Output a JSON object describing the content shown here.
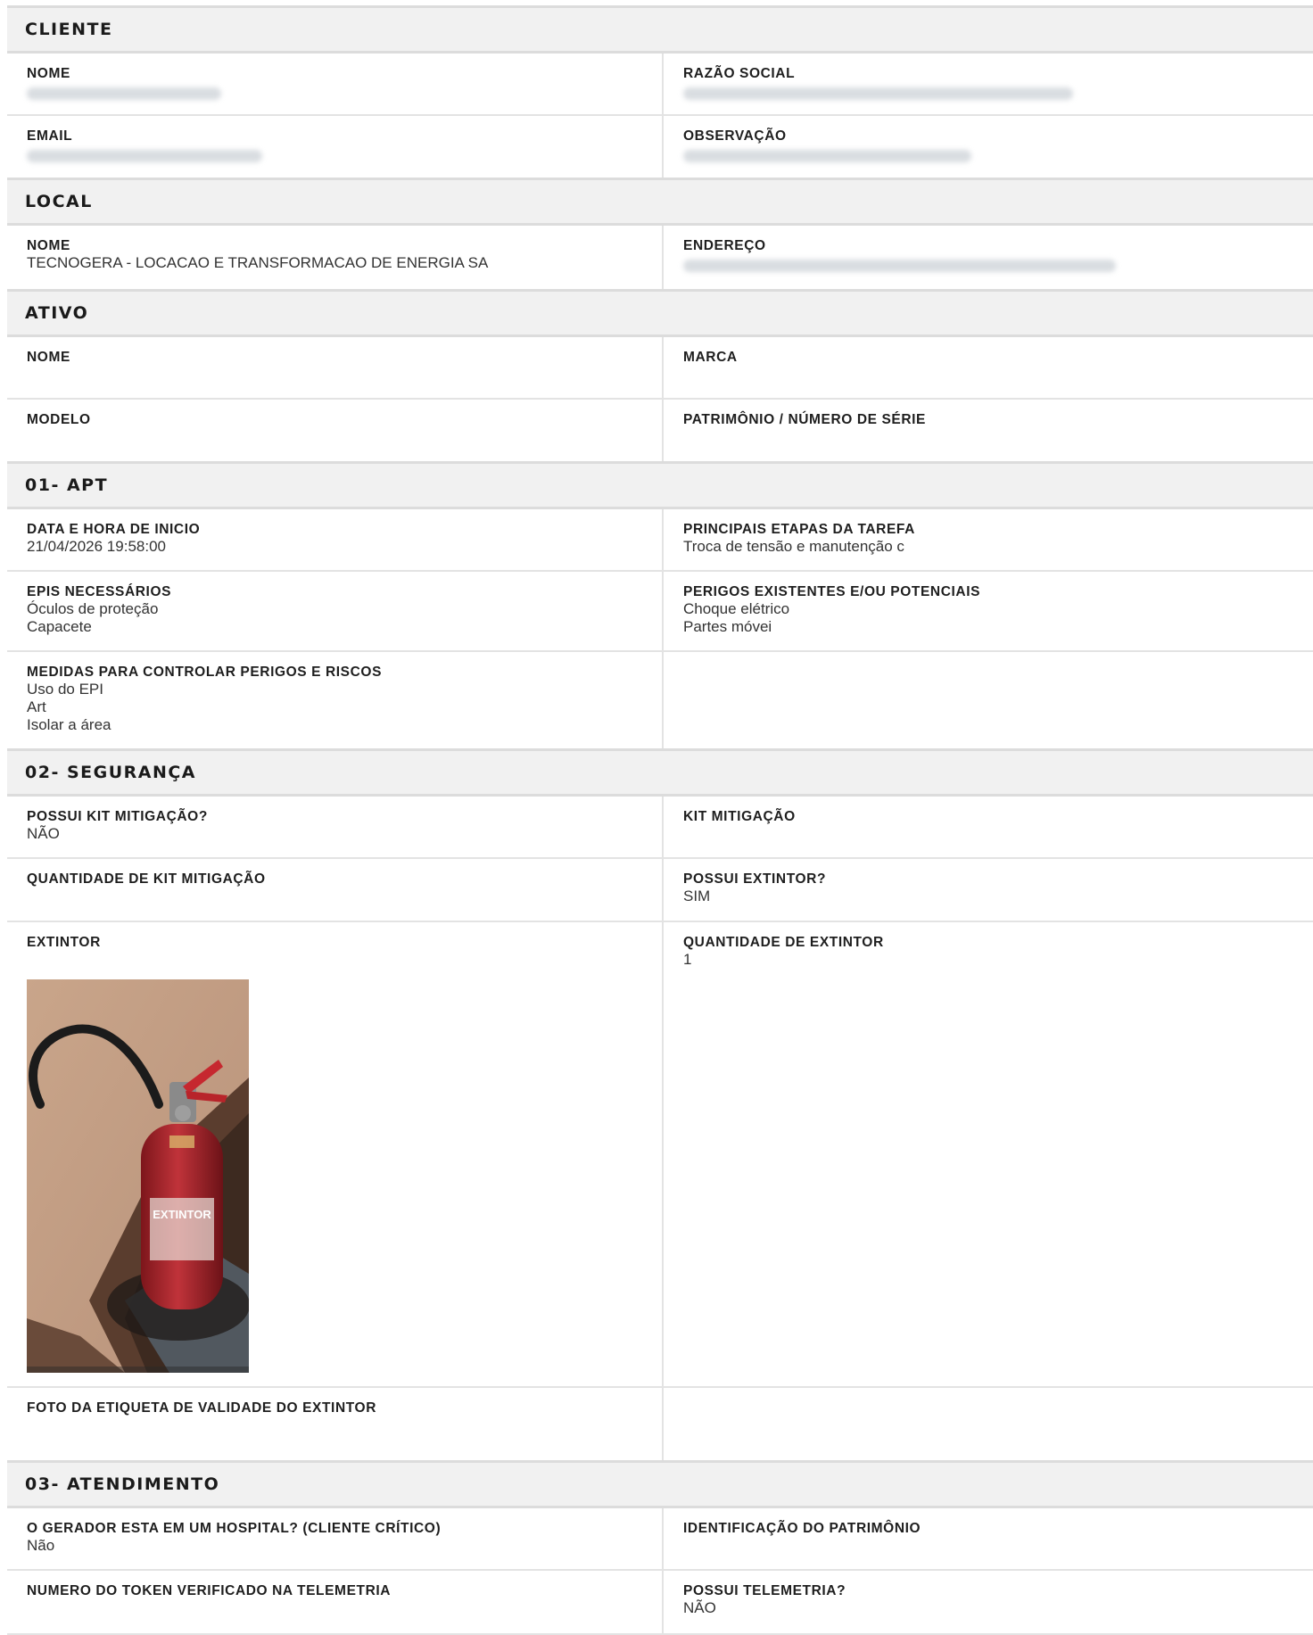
{
  "cliente": {
    "title": "CLIENTE",
    "nome_label": "NOME",
    "razao_label": "RAZÃO SOCIAL",
    "email_label": "EMAIL",
    "observacao_label": "OBSERVAÇÃO"
  },
  "local": {
    "title": "LOCAL",
    "nome_label": "NOME",
    "nome_value": "TECNOGERA - LOCACAO E TRANSFORMACAO DE ENERGIA SA",
    "endereco_label": "ENDEREÇO"
  },
  "ativo": {
    "title": "ATIVO",
    "nome_label": "NOME",
    "marca_label": "MARCA",
    "modelo_label": "MODELO",
    "patrimonio_label": "PATRIMÔNIO / NÚMERO DE SÉRIE"
  },
  "apt": {
    "title": "01- APT",
    "data_label": "DATA E HORA DE INICIO",
    "data_value": "21/04/2026 19:58:00",
    "etapas_label": "PRINCIPAIS ETAPAS DA TAREFA",
    "etapas_value": "Troca de tensão e manutenção c",
    "epis_label": "EPIS NECESSÁRIOS",
    "epis_value": "Óculos de proteção\nCapacete",
    "perigos_label": "PERIGOS EXISTENTES E/OU POTENCIAIS",
    "perigos_value": "Choque elétrico\nPartes móvei",
    "medidas_label": "MEDIDAS PARA CONTROLAR PERIGOS E RISCOS",
    "medidas_value": "Uso do EPI\nArt\nIsolar a área"
  },
  "seguranca": {
    "title": "02- SEGURANÇA",
    "possui_kit_label": "POSSUI KIT MITIGAÇÃO?",
    "possui_kit_value": "NÃO",
    "kit_label": "KIT MITIGAÇÃO",
    "qtd_kit_label": "QUANTIDADE DE KIT MITIGAÇÃO",
    "possui_extintor_label": "POSSUI EXTINTOR?",
    "possui_extintor_value": "SIM",
    "extintor_label": "EXTINTOR",
    "qtd_extintor_label": "QUANTIDADE DE EXTINTOR",
    "qtd_extintor_value": "1",
    "foto_etiqueta_label": "FOTO DA ETIQUETA DE VALIDADE DO EXTINTOR",
    "extintor_photo_text": "EXTINTOR"
  },
  "atendimento": {
    "title": "03- ATENDIMENTO",
    "hospital_label": "O GERADOR ESTA EM UM HOSPITAL? (CLIENTE CRÍTICO)",
    "hospital_value": "Não",
    "identificacao_label": "IDENTIFICAÇÃO DO PATRIMÔNIO",
    "token_label": "NUMERO DO TOKEN VERIFICADO NA TELEMETRIA",
    "telemetria_label": "POSSUI TELEMETRIA?",
    "telemetria_value": "NÃO"
  },
  "colors": {
    "section_bg": "#f1f1f1",
    "border": "#dcdcdc",
    "extinguisher_red": "#b3262c"
  }
}
